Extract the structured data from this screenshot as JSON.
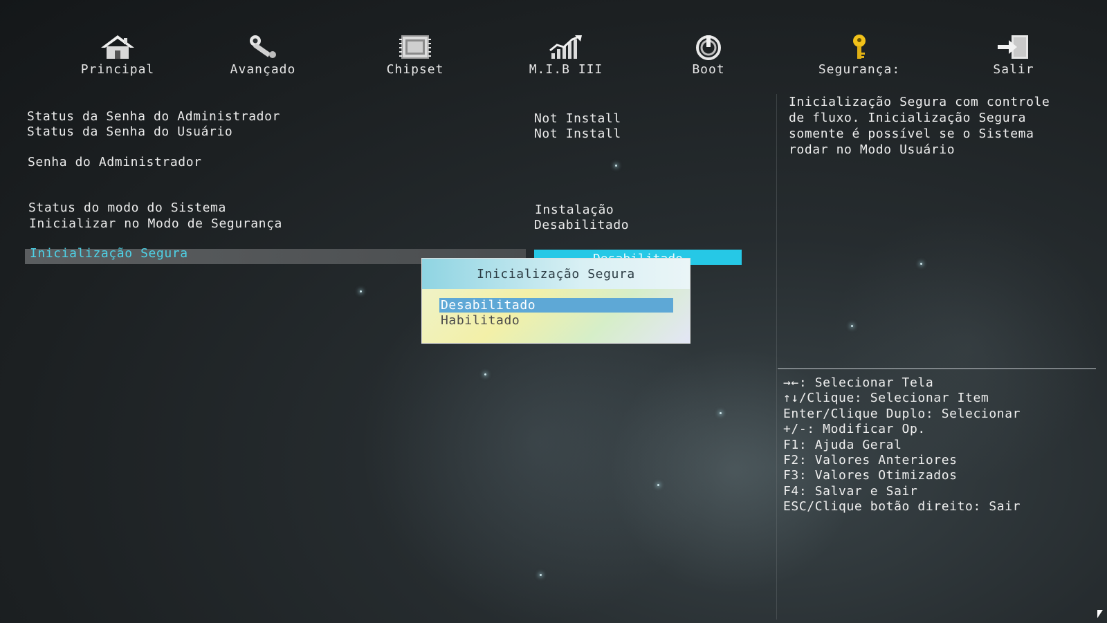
{
  "colors": {
    "background": "#1f2426",
    "selected_text": "#4ed3e8",
    "value_highlight": "#26c8e6",
    "popup_header": "#8fd4e2",
    "option_highlight": "#5ea8d6"
  },
  "nav": {
    "tabs": [
      {
        "label": "Principal",
        "icon": "home-icon"
      },
      {
        "label": "Avançado",
        "icon": "wrench-icon"
      },
      {
        "label": "Chipset",
        "icon": "chip-icon"
      },
      {
        "label": "M.I.B III",
        "icon": "chart-icon"
      },
      {
        "label": "Boot",
        "icon": "power-icon"
      },
      {
        "label": "Segurança:",
        "icon": "key-icon"
      },
      {
        "label": "Salir",
        "icon": "exit-icon"
      }
    ],
    "active": "Segurança:"
  },
  "settings": {
    "admin_password_status": {
      "label": "Status da Senha do Administrador",
      "value": "Not Install"
    },
    "user_password_status": {
      "label": "Status da Senha do Usuário",
      "value": "Not Install"
    },
    "admin_password": {
      "label": "Senha do Administrador"
    },
    "system_mode_status": {
      "label": "Status do modo do Sistema",
      "value": "Instalação"
    },
    "safe_mode_boot": {
      "label": "Inicializar no Modo de Segurança",
      "value": "Desabilitado"
    },
    "secure_boot": {
      "label": "Inicialização Segura",
      "value": "Desabilitado"
    }
  },
  "popup": {
    "title": "Inicialização Segura",
    "options": [
      "Desabilitado",
      "Habilitado"
    ],
    "selected": "Desabilitado"
  },
  "help": {
    "lines": [
      "Inicialização Segura com controle",
      "de fluxo. Inicialização Segura",
      "somente é possível se o Sistema",
      "rodar no Modo Usuário"
    ]
  },
  "keys": [
    "→←: Selecionar Tela",
    "↑↓/Clique: Selecionar Item",
    "Enter/Clique Duplo: Selecionar",
    "+/-: Modificar Op.",
    "F1: Ajuda Geral",
    "F2: Valores Anteriores",
    "F3: Valores Otimizados",
    "F4: Salvar e Sair",
    "ESC/Clique botão direito: Sair"
  ]
}
